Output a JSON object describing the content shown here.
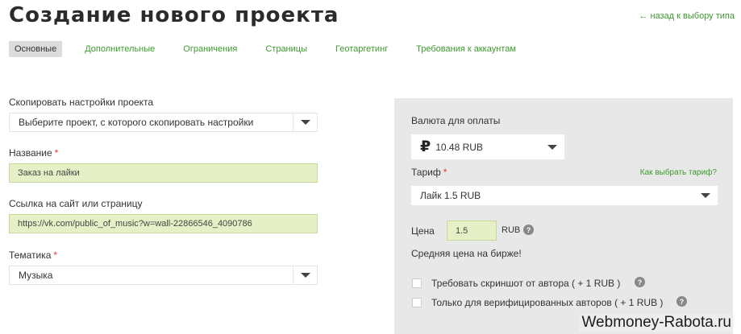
{
  "header": {
    "title": "Создание нового проекта",
    "back_link": "← назад к выбору типа"
  },
  "tabs": [
    {
      "label": "Основные",
      "active": true
    },
    {
      "label": "Дополнительные"
    },
    {
      "label": "Ограничения"
    },
    {
      "label": "Страницы"
    },
    {
      "label": "Геотаргетинг"
    },
    {
      "label": "Требования к аккаунтам"
    }
  ],
  "form": {
    "copy_settings": {
      "label": "Скопировать настройки проекта",
      "value": "Выберите проект, с которого скопировать настройки"
    },
    "name": {
      "label": "Название",
      "required_mark": "*",
      "value": "Заказ на лайки"
    },
    "link": {
      "label": "Ссылка на сайт или страницу",
      "value": "https://vk.com/public_of_music?w=wall-22866546_4090786"
    },
    "topic": {
      "label": "Тематика",
      "required_mark": "*",
      "value": "Музыка"
    }
  },
  "payment": {
    "currency_label": "Валюта для оплаты",
    "currency_symbol": "₽",
    "currency_value": "10.48 RUB",
    "tariff_label": "Тариф",
    "tariff_required_mark": "*",
    "tariff_help_link": "Как выбрать тариф?",
    "tariff_value": "Лайк 1.5 RUB",
    "price_label": "Цена",
    "price_value": "1.5",
    "price_unit": "RUB",
    "avg_price_note": "Средняя цена на бирже!",
    "options": [
      {
        "label": "Требовать скриншот от автора ( + 1 RUB )",
        "checked": false
      },
      {
        "label": "Только для верифицированных авторов ( + 1 RUB )",
        "checked": false
      }
    ],
    "help_glyph": "?"
  },
  "watermark": "Webmoney-Rabota.ru",
  "colors": {
    "accent_green": "#3c9a2d",
    "input_green_bg": "#e6f0c6",
    "required_red": "#e53935",
    "panel_gray": "#e8e8e8"
  }
}
